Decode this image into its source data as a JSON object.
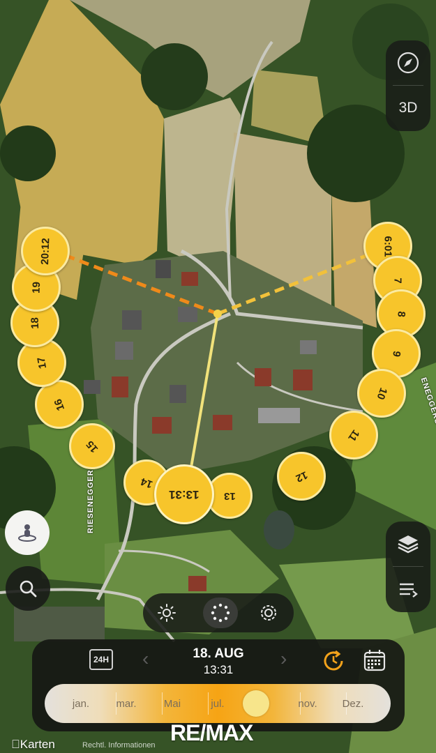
{
  "sun_times": {
    "sunrise": "6:01",
    "sunset": "20:12",
    "current": "13:31",
    "hours": [
      "7",
      "8",
      "9",
      "10",
      "11",
      "12",
      "13",
      "14",
      "15",
      "16",
      "17",
      "18",
      "19"
    ]
  },
  "map_controls": {
    "compass_icon": "compass-icon",
    "three_d_label": "3D",
    "layers_icon": "layers-icon",
    "list_icon": "list-icon",
    "person_icon": "person-location-icon",
    "search_icon": "search-icon"
  },
  "street_labels": {
    "left": "RIESENEGGERSTRASSE",
    "right": "ENEGGERS"
  },
  "modes": {
    "sun": "sun-icon",
    "path": "sun-path-icon",
    "settings": "gear-icon"
  },
  "date_panel": {
    "toggle_24h": "24H",
    "date": "18. AUG",
    "time": "13:31",
    "months": [
      "jan.",
      "mar.",
      "Mai",
      "jul.",
      "",
      "nov.",
      "Dez."
    ],
    "progress": 0.62
  },
  "footer": {
    "brand": "RE/MAX",
    "maps_app": "Karten",
    "legal": "Rechtl. Informationen"
  },
  "colors": {
    "sun": "#f7c52b",
    "sunrise_line": "#f2c13a",
    "sunset_line": "#ef8a1a",
    "noon_line": "#f1e27b",
    "accent": "#f2a21b"
  }
}
